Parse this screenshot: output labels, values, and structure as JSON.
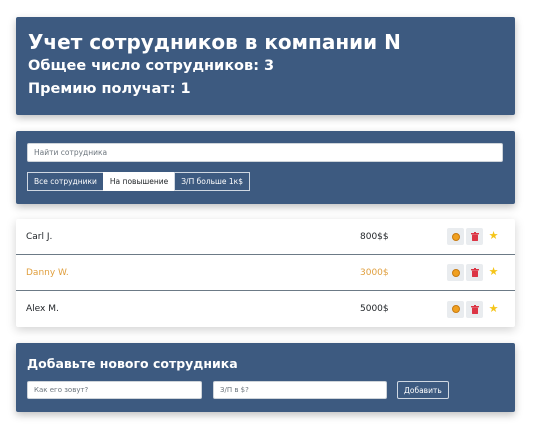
{
  "header": {
    "title": "Учет сотрудников в компании N",
    "total": "Общее число сотрудников: 3",
    "bonus": "Премию получат: 1"
  },
  "search": {
    "placeholder": "Найти сотрудника"
  },
  "filters": [
    {
      "label": "Все сотрудники",
      "active": false
    },
    {
      "label": "На повышение",
      "active": true
    },
    {
      "label": "З/П больше 1к$",
      "active": false
    }
  ],
  "employees": [
    {
      "name": "Carl J.",
      "salary": "800$$",
      "increase": false
    },
    {
      "name": "Danny W.",
      "salary": "3000$",
      "increase": true
    },
    {
      "name": "Alex M.",
      "salary": "5000$",
      "increase": false
    }
  ],
  "add_form": {
    "title": "Добавьте нового сотрудника",
    "name_placeholder": "Как его зовут?",
    "salary_placeholder": "З/П в $?",
    "submit_label": "Добавить"
  },
  "colors": {
    "panel": "#3d5a80",
    "increase_text": "#e09f3e",
    "star": "#f5c518",
    "trash": "#dc3545"
  }
}
